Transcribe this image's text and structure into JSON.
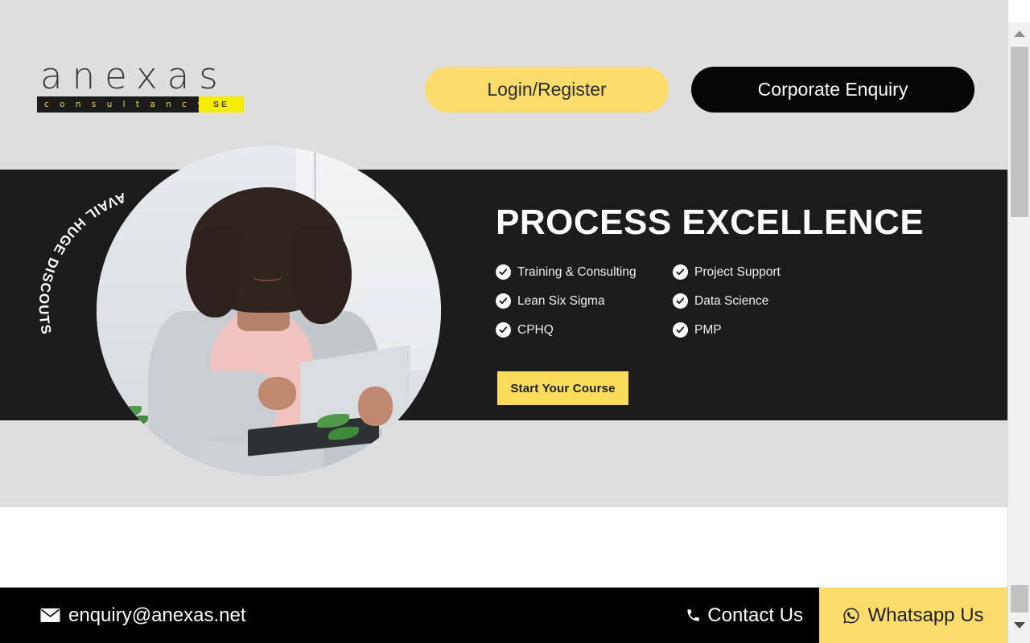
{
  "brand": {
    "logo_word": "anexas",
    "logo_sub": "c o n s u l t a n c y",
    "logo_badge": "SE"
  },
  "header": {
    "login_button": "Login/Register",
    "corporate_button": "Corporate Enquiry"
  },
  "hero": {
    "arc_text": "AVAIL HUGE DISCOUTS",
    "title": "PROCESS EXCELLENCE",
    "features": [
      {
        "label": "Training & Consulting",
        "icon": "check-circle-icon"
      },
      {
        "label": "Project Support",
        "icon": "check-circle-icon"
      },
      {
        "label": "Lean Six Sigma",
        "icon": "check-circle-icon"
      },
      {
        "label": "Data Science",
        "icon": "check-circle-icon"
      },
      {
        "label": "CPHQ",
        "icon": "check-circle-icon"
      },
      {
        "label": "PMP",
        "icon": "check-circle-icon"
      }
    ],
    "cta_button": "Start Your Course",
    "photo_alt": "woman-with-laptop-photo"
  },
  "footer": {
    "email": "enquiry@anexas.net",
    "email_icon": "envelope-icon",
    "contact": "Contact Us",
    "contact_icon": "phone-icon",
    "whatsapp": "Whatsapp Us",
    "whatsapp_icon": "whatsapp-icon"
  },
  "colors": {
    "accent_yellow": "#fcdc6d",
    "cta_yellow": "#f9dc5c",
    "dark": "#1c1c1c",
    "page_grey": "#dedede",
    "badge_yellow": "#f5ec00"
  }
}
